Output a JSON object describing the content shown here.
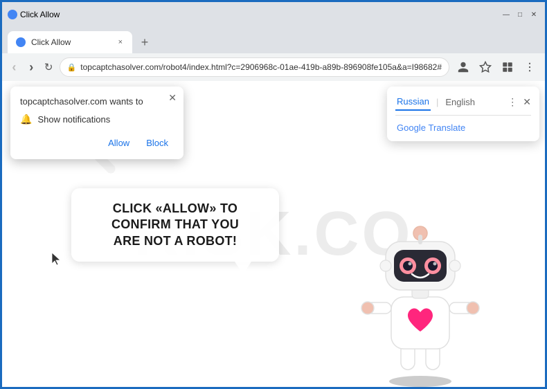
{
  "browser": {
    "title": "Click Allow",
    "tab_title": "Click Allow",
    "url": "topcaptchasolver.com/robot4/index.html?c=2906968c-01ae-419b-a89b-896908fe105a&a=I98682#",
    "new_tab_label": "+",
    "close_tab": "×"
  },
  "window_controls": {
    "minimize": "—",
    "maximize": "□",
    "close": "✕"
  },
  "nav": {
    "back": "‹",
    "forward": "›",
    "refresh": "↻"
  },
  "notification_popup": {
    "title": "topcaptchasolver.com wants to",
    "notification_label": "Show notifications",
    "allow_label": "Allow",
    "block_label": "Block",
    "close": "✕"
  },
  "translate_popup": {
    "tab_russian": "Russian",
    "tab_english": "English",
    "body": "Google Translate",
    "close": "✕"
  },
  "page": {
    "bubble_line1": "CLICK «ALLOW» TO CONFIRM THAT YOU",
    "bubble_line2": "ARE NOT A ROBOT!"
  },
  "watermark": {
    "text": "RISK.CO"
  }
}
